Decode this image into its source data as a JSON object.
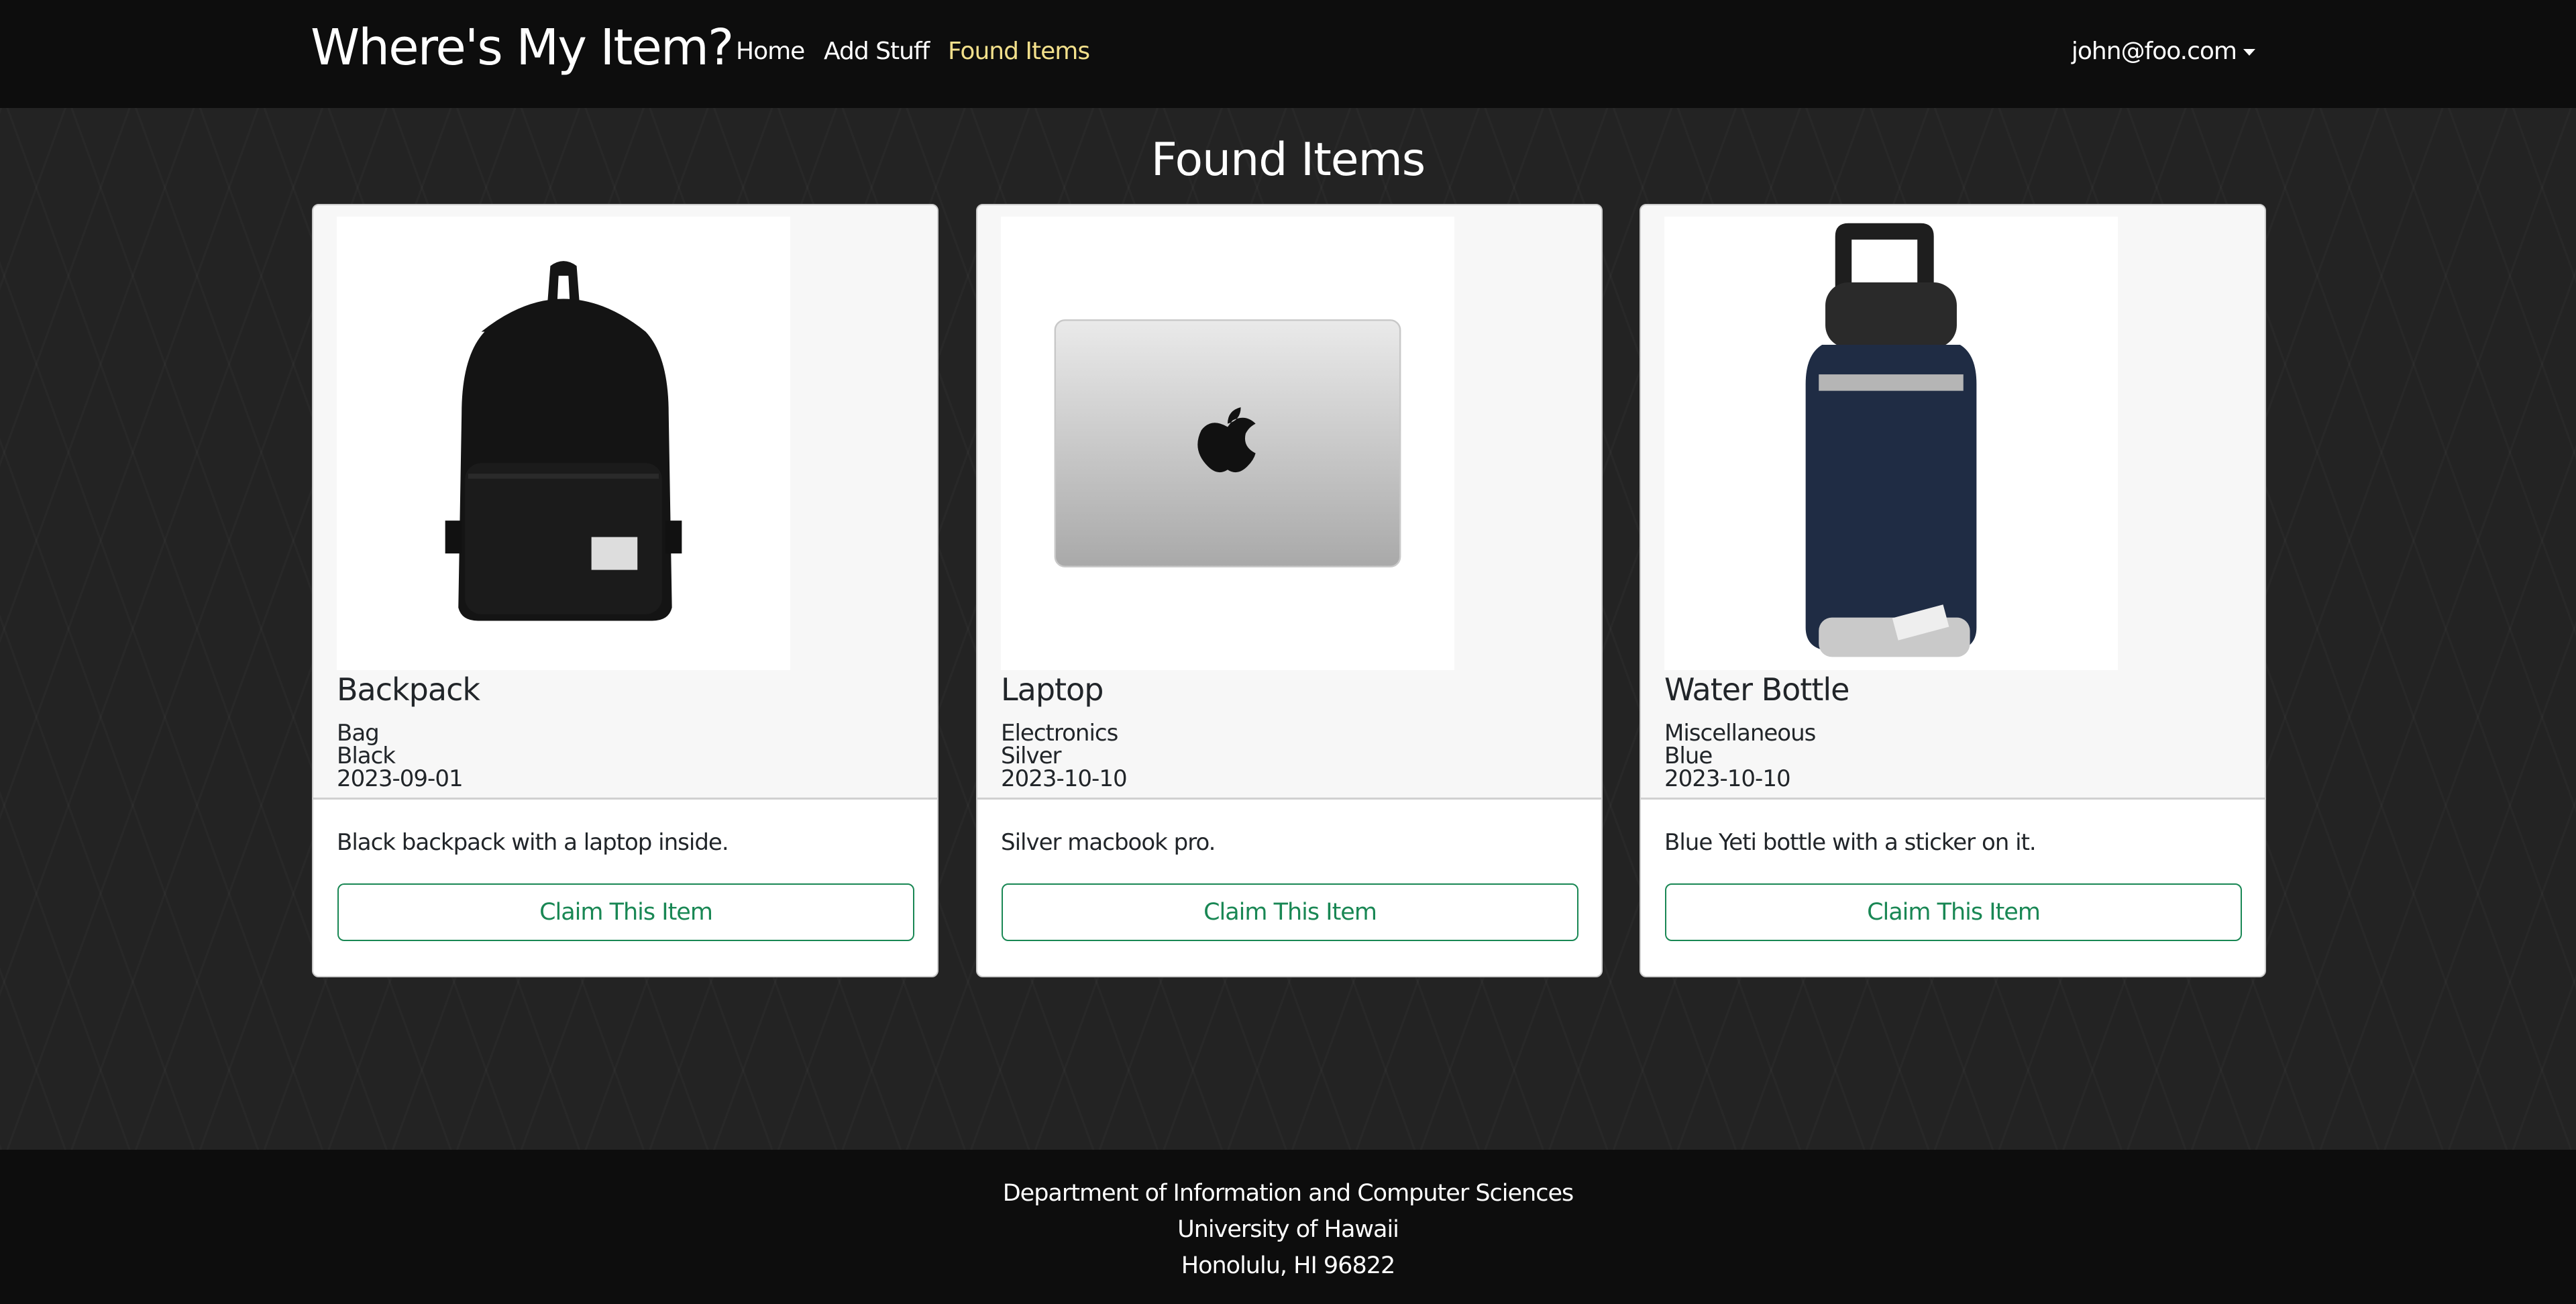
{
  "navbar": {
    "brand": "Where's My Item?",
    "links": [
      {
        "label": "Home",
        "active": false
      },
      {
        "label": "Add Stuff",
        "active": false
      },
      {
        "label": "Found Items",
        "active": true
      }
    ],
    "user": "john@foo.com",
    "active_color": "#f3e08b"
  },
  "page": {
    "title": "Found Items"
  },
  "items": [
    {
      "name": "Backpack",
      "category": "Bag",
      "color": "Black",
      "date": "2023-09-01",
      "description": "Black backpack with a laptop inside.",
      "button": "Claim This Item",
      "image": "backpack"
    },
    {
      "name": "Laptop",
      "category": "Electronics",
      "color": "Silver",
      "date": "2023-10-10",
      "description": "Silver macbook pro.",
      "button": "Claim This Item",
      "image": "laptop"
    },
    {
      "name": "Water Bottle",
      "category": "Miscellaneous",
      "color": "Blue",
      "date": "2023-10-10",
      "description": "Blue Yeti bottle with a sticker on it.",
      "button": "Claim This Item",
      "image": "water-bottle"
    }
  ],
  "footer": {
    "lines": [
      "Department of Information and Computer Sciences",
      "University of Hawaii",
      "Honolulu, HI 96822"
    ]
  },
  "colors": {
    "button": "#198754",
    "navbar": "#0d0d0d"
  }
}
